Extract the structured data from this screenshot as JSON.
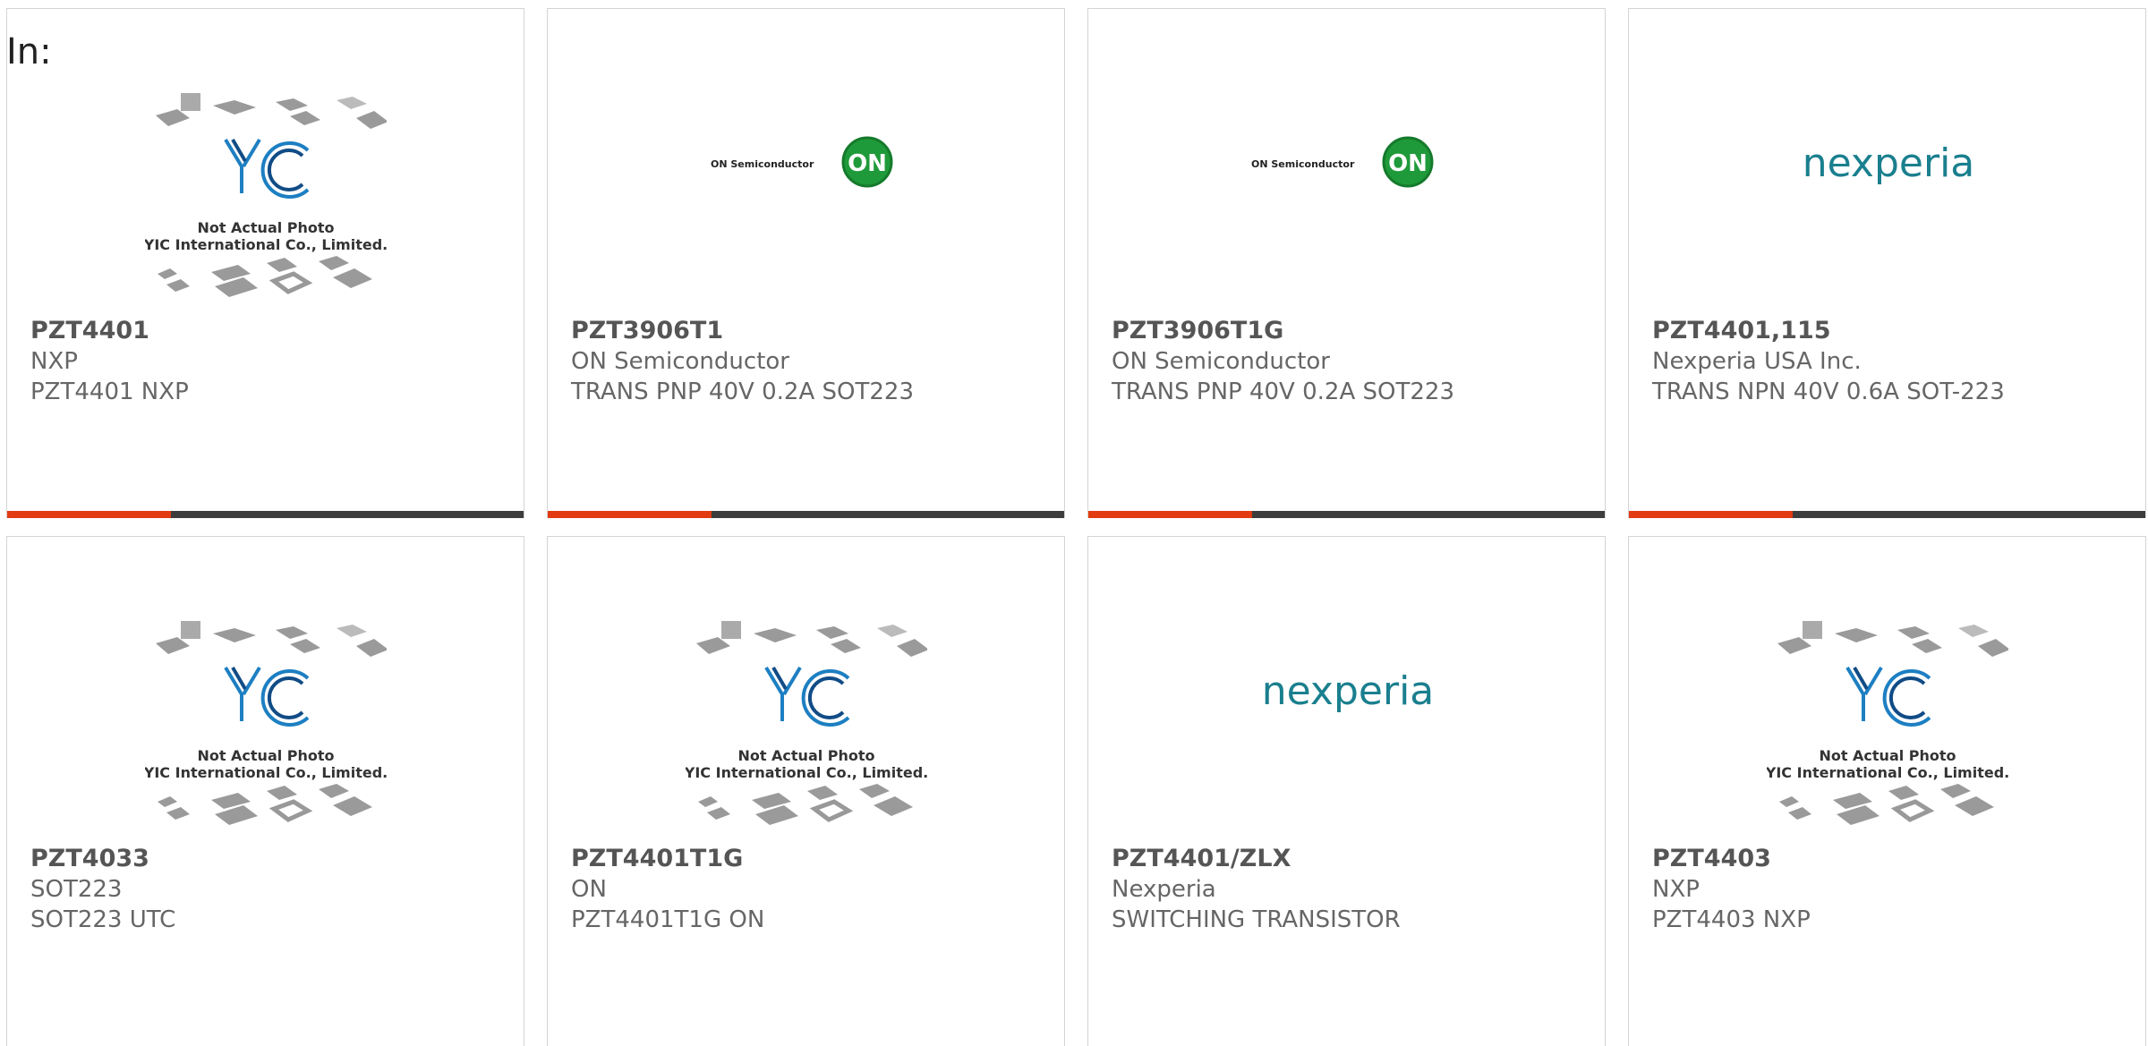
{
  "page": {
    "label": "In:"
  },
  "images": {
    "yic_line1": "Not Actual Photo",
    "yic_line2": "YIC International Co., Limited.",
    "on_text": "ON Semiconductor",
    "on_badge": "ON",
    "nexperia_text": "nexperia"
  },
  "colors": {
    "accent": "#e23a12",
    "bar": "#3d3d3d",
    "nexperia": "#1a7f8e",
    "on_green": "#1f9a3a"
  },
  "cards": [
    {
      "part": "PZT4401",
      "manufacturer": "NXP",
      "description": "PZT4401 NXP",
      "logo": "yic-placeholder"
    },
    {
      "part": "PZT3906T1",
      "manufacturer": "ON Semiconductor",
      "description": "TRANS PNP 40V 0.2A SOT223",
      "logo": "on-semiconductor"
    },
    {
      "part": "PZT3906T1G",
      "manufacturer": "ON Semiconductor",
      "description": "TRANS PNP 40V 0.2A SOT223",
      "logo": "on-semiconductor"
    },
    {
      "part": "PZT4401,115",
      "manufacturer": "Nexperia USA Inc.",
      "description": "TRANS NPN 40V 0.6A SOT-223",
      "logo": "nexperia"
    },
    {
      "part": "PZT4033",
      "manufacturer": "SOT223",
      "description": "SOT223 UTC",
      "logo": "yic-placeholder"
    },
    {
      "part": "PZT4401T1G",
      "manufacturer": "ON",
      "description": "PZT4401T1G ON",
      "logo": "yic-placeholder"
    },
    {
      "part": "PZT4401/ZLX",
      "manufacturer": "Nexperia",
      "description": "SWITCHING TRANSISTOR",
      "logo": "nexperia"
    },
    {
      "part": "PZT4403",
      "manufacturer": "NXP",
      "description": "PZT4403 NXP",
      "logo": "yic-placeholder"
    }
  ]
}
